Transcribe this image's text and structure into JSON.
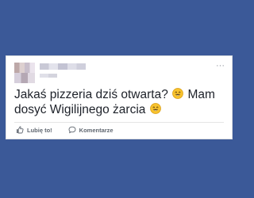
{
  "post": {
    "menu_label": "···",
    "text_part1": "Jakaś pizzeria dziś otwarta?",
    "text_part2": "Mam dosyć Wigilijnego żarcia",
    "emoji_1": "smiling-face-icon",
    "emoji_2": "smiling-face-icon"
  },
  "actions": {
    "like_label": "Lubię to!",
    "comment_label": "Komentarze"
  },
  "colors": {
    "background": "#3b5998",
    "card": "#ffffff",
    "text": "#1d2129",
    "action_text": "#606770"
  }
}
